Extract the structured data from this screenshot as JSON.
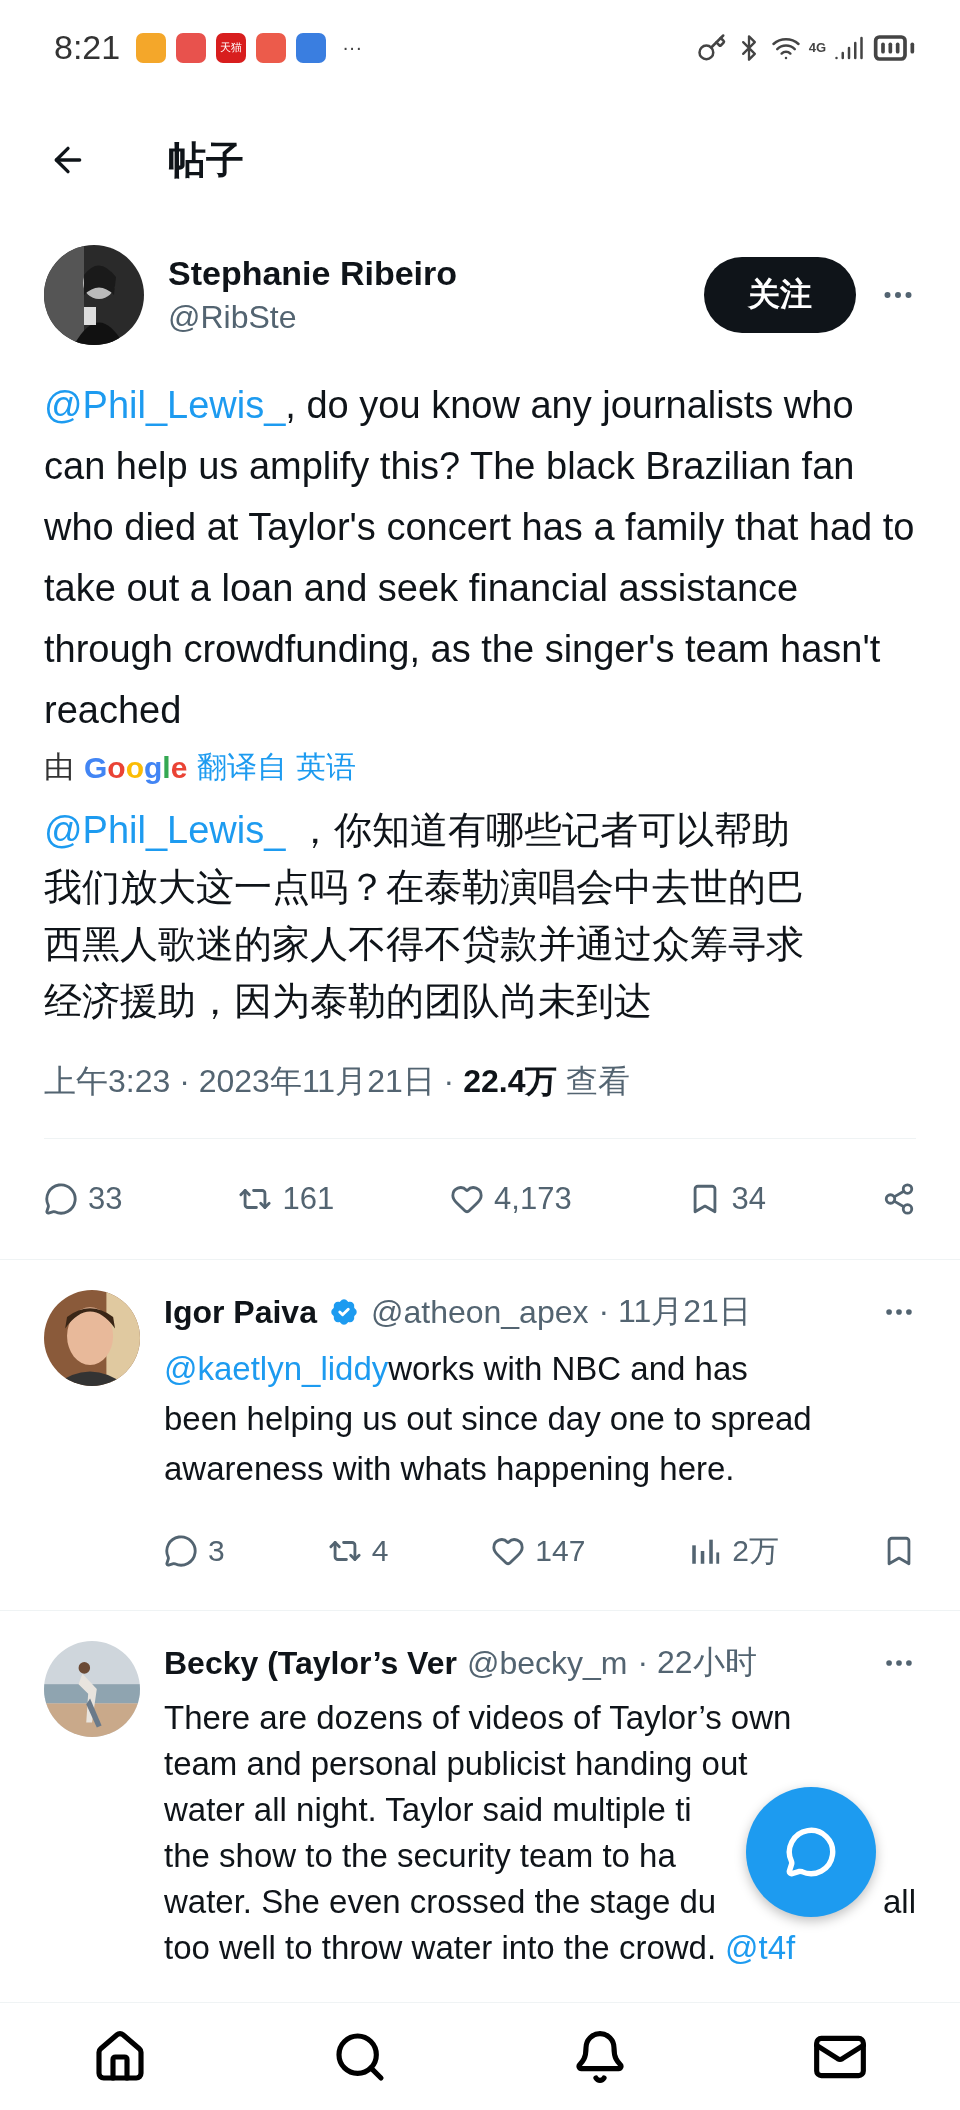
{
  "status_bar": {
    "time": "8:21",
    "apps": [
      {
        "color": "#f4a72a"
      },
      {
        "color": "#e8524d"
      },
      {
        "color": "#d81e1e",
        "label": "天猫"
      },
      {
        "color": "#ec5b4b"
      },
      {
        "color": "#3a7ee0"
      }
    ],
    "more": "···",
    "network": "4G"
  },
  "header": {
    "title": "帖子"
  },
  "post": {
    "author": "Stephanie Ribeiro",
    "handle": "@RibSte",
    "follow": "关注",
    "mention": "@Phil_Lewis_",
    "text": ", do you know any journalists who can help us amplify this? The black Brazilian fan who died at Taylor's concert has a family that had to take out a loan and seek financial assistance through crowdfunding, as the singer's team hasn't reached",
    "translation": {
      "prefix": "由",
      "logo": "Google",
      "suffix": "翻译自 英语"
    },
    "translated_mention": "@Phil_Lewis_",
    "translated_text": " ，你知道有哪些记者可以帮助我们放大这一点吗？在泰勒演唱会中去世的巴西黑人歌迷的家人不得不贷款并通过众筹寻求经济援助，因为泰勒的团队尚未到达",
    "meta": "上午3:23 · 2023年11月21日 · **22.4万** 查看",
    "actions": [
      {
        "kind": "reply",
        "count": "33"
      },
      {
        "kind": "repost",
        "count": "161"
      },
      {
        "kind": "like",
        "count": "4,173"
      },
      {
        "kind": "bookmark",
        "count": "34"
      },
      {
        "kind": "share"
      }
    ]
  },
  "replies": [
    {
      "name": "Igor Paiva",
      "verified": true,
      "handle": "@atheon_apex",
      "time": "· 11月21日",
      "lines": [
        {
          "mention": "@kaetlyn_liddy",
          "text": " works with NBC and has"
        },
        {
          "text": "been helping us out since day one to spread"
        },
        {
          "text": "awareness with whats happening here."
        }
      ],
      "actions": [
        {
          "kind": "reply",
          "count": "3"
        },
        {
          "kind": "repost",
          "count": "4"
        },
        {
          "kind": "like",
          "count": "147"
        },
        {
          "kind": "views",
          "count": "2万"
        },
        {
          "kind": "bookmark"
        }
      ]
    },
    {
      "name": "Becky (Taylor’s Ver",
      "verified": false,
      "handle": "@becky_m",
      "time": "· 22小时",
      "lines": [
        {
          "text": "There are dozens of videos of Taylor’s own"
        },
        {
          "text": "team and personal publicist handing out"
        },
        {
          "text": "water all night. Taylor said multiple ti"
        },
        {
          "text": "the show to the security team to ha"
        },
        {
          "text": "water. She even crossed the stage du",
          "tail": "all"
        },
        {
          "text": "too well to throw water into the crowd.",
          "end_mention": "@t4f"
        }
      ]
    }
  ]
}
